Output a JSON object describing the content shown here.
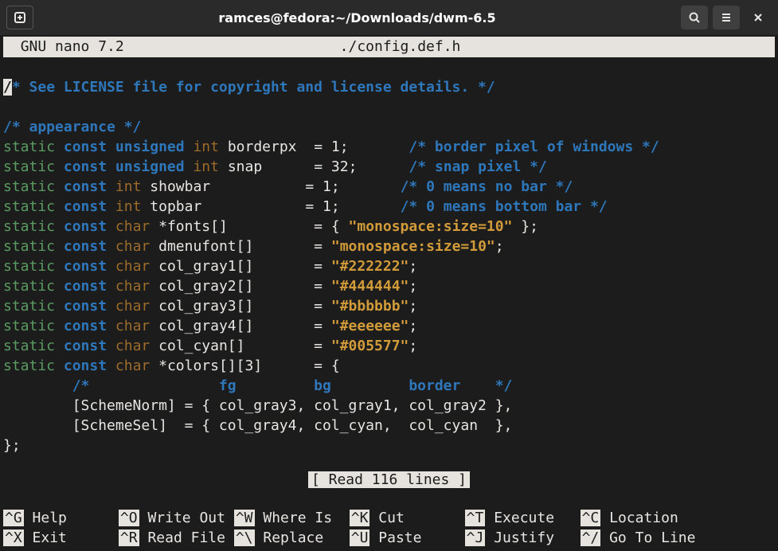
{
  "window": {
    "title": "ramces@fedora:~/Downloads/dwm-6.5"
  },
  "nano": {
    "app": "GNU nano 7.2",
    "filename": "./config.def.h",
    "status": "[ Read 116 lines ]"
  },
  "code": {
    "c1": "* See LICENSE file for copyright and license details. */",
    "c2": "/* appearance */",
    "l1": {
      "id": "borderpx",
      "align": "borderpx ",
      "val": "1",
      "vsp": "       ",
      "cm": "/* border pixel of windows */"
    },
    "l2": {
      "id": "snap",
      "align": "snap     ",
      "val": "32",
      "vsp": "      ",
      "cm": "/* snap pixel */"
    },
    "l3": {
      "id": "showbar",
      "align": "showbar          ",
      "val": "1",
      "vsp": "       ",
      "cm": "/* 0 means no bar */"
    },
    "l4": {
      "id": "topbar",
      "align": "topbar           ",
      "val": "1",
      "vsp": "       ",
      "cm": "/* 0 means bottom bar */"
    },
    "l5": {
      "id": "*fonts[]",
      "align": "*fonts[]         ",
      "str": "\"monospace:size=10\"",
      "tail": " };"
    },
    "l6": {
      "id": "dmenufont[]",
      "align": "dmenufont[]      ",
      "str": "\"monospace:size=10\"",
      "tail": ";"
    },
    "l7": {
      "id": "col_gray1[]",
      "align": "col_gray1[]      ",
      "str": "\"#222222\"",
      "tail": ";"
    },
    "l8": {
      "id": "col_gray2[]",
      "align": "col_gray2[]      ",
      "str": "\"#444444\"",
      "tail": ";"
    },
    "l9": {
      "id": "col_gray3[]",
      "align": "col_gray3[]      ",
      "str": "\"#bbbbbb\"",
      "tail": ";"
    },
    "l10": {
      "id": "col_gray4[]",
      "align": "col_gray4[]      ",
      "str": "\"#eeeeee\"",
      "tail": ";"
    },
    "l11": {
      "id": "col_cyan[]",
      "align": "col_cyan[]       ",
      "str": "\"#005577\"",
      "tail": ";"
    },
    "l12": {
      "id": "*colors[][3]",
      "align": "*colors[][3]     "
    },
    "c3hdr": "        /*               fg         bg         border    */",
    "l13": "        [SchemeNorm] = { col_gray3, col_gray1, col_gray2 },",
    "l14": "        [SchemeSel]  = { col_gray4, col_cyan,  col_cyan  },",
    "l15": "};"
  },
  "shortcuts": {
    "r1": [
      {
        "k": "^G",
        "l": "Help"
      },
      {
        "k": "^O",
        "l": "Write Out"
      },
      {
        "k": "^W",
        "l": "Where Is"
      },
      {
        "k": "^K",
        "l": "Cut"
      },
      {
        "k": "^T",
        "l": "Execute"
      },
      {
        "k": "^C",
        "l": "Location"
      }
    ],
    "r2": [
      {
        "k": "^X",
        "l": "Exit"
      },
      {
        "k": "^R",
        "l": "Read File"
      },
      {
        "k": "^\\",
        "l": "Replace"
      },
      {
        "k": "^U",
        "l": "Paste"
      },
      {
        "k": "^J",
        "l": "Justify"
      },
      {
        "k": "^/",
        "l": "Go To Line"
      }
    ]
  }
}
